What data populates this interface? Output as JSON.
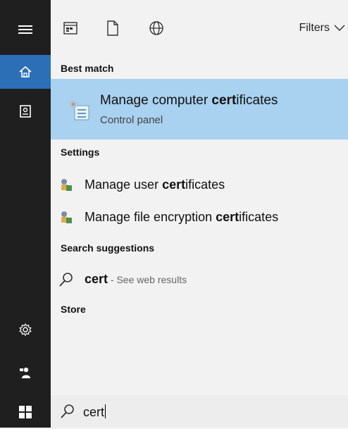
{
  "topbar": {
    "filters_label": "Filters"
  },
  "sections": {
    "best_match": "Best match",
    "settings": "Settings",
    "search_suggestions": "Search suggestions",
    "store": "Store"
  },
  "best_match": {
    "title_pre": "Manage computer ",
    "title_bold": "cert",
    "title_post": "ificates",
    "subtitle": "Control panel"
  },
  "settings_items": [
    {
      "pre": "Manage user ",
      "bold": "cert",
      "post": "ificates"
    },
    {
      "pre": "Manage file encryption ",
      "bold": "cert",
      "post": "ificates"
    }
  ],
  "suggestion": {
    "bold": "cert",
    "hint": " - See web results"
  },
  "search": {
    "value": "cert"
  },
  "sidebar": {
    "icons": [
      "hamburger-menu-icon",
      "home-icon",
      "device-icon",
      "settings-gear-icon",
      "user-feedback-icon",
      "windows-start-icon"
    ]
  },
  "colors": {
    "sidebar_bg": "#1f1f1f",
    "active_accent": "#2c6fb7",
    "selection_bg": "#a9d1f0",
    "panel_bg": "#f2f2f2"
  }
}
